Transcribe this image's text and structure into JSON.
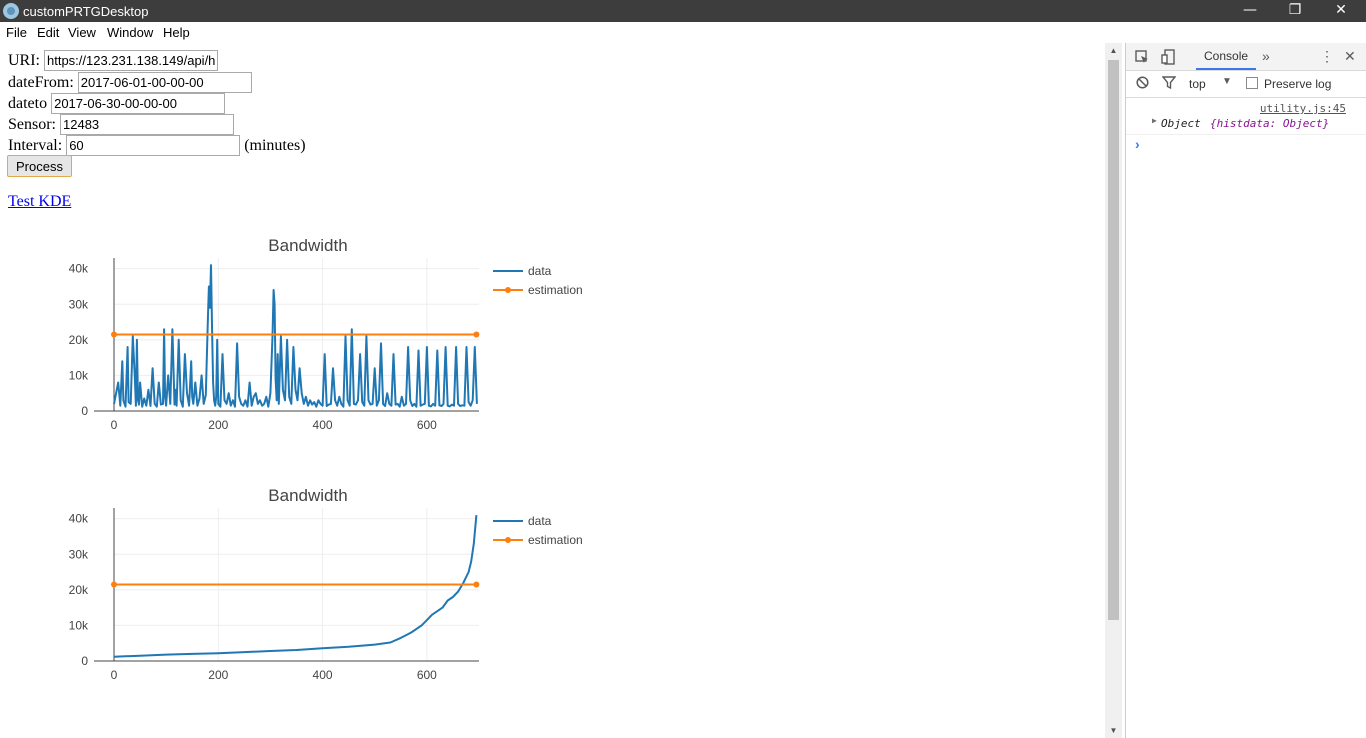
{
  "window": {
    "title": "customPRTGDesktop",
    "minimize": "—",
    "restore": "❐",
    "close": "✕"
  },
  "menu": [
    "File",
    "Edit",
    "View",
    "Window",
    "Help"
  ],
  "form": {
    "uri_label": "URI:",
    "uri_value": "https://123.231.138.149/api/h",
    "datefrom_label": "dateFrom:",
    "datefrom_value": "2017-06-01-00-00-00",
    "dateto_label": "dateto",
    "dateto_value": "2017-06-30-00-00-00",
    "sensor_label": "Sensor:",
    "sensor_value": "12483",
    "interval_label": "Interval:",
    "interval_value": "60",
    "interval_unit": "(minutes)",
    "process_label": "Process"
  },
  "link": {
    "label": "Test KDE"
  },
  "devtools": {
    "tab_console": "Console",
    "more_tabs": "»",
    "context": "top",
    "preserve_log": "Preserve log",
    "log_source": "utility.js:45",
    "log_prefix": "Object ",
    "log_body": "{histdata: Object}",
    "prompt": "›"
  },
  "colors": {
    "data": "#1f77b4",
    "estimation": "#ff7f0e"
  },
  "chart_data": [
    {
      "type": "line",
      "title": "Bandwidth",
      "ylim": [
        0,
        43000
      ],
      "xlim": [
        0,
        700
      ],
      "xticks": [
        0,
        200,
        400,
        600
      ],
      "yticks": [
        0,
        10000,
        20000,
        30000,
        40000
      ],
      "ytick_labels": [
        "0",
        "10k",
        "20k",
        "30k",
        "40k"
      ],
      "legend_position": "top-right",
      "grid": true,
      "series": [
        {
          "name": "data",
          "x": [
            0,
            8,
            12,
            16,
            18,
            22,
            26,
            28,
            32,
            36,
            40,
            42,
            44,
            46,
            48,
            50,
            54,
            58,
            62,
            66,
            70,
            74,
            78,
            82,
            86,
            90,
            94,
            96,
            98,
            100,
            104,
            108,
            112,
            116,
            118,
            120,
            124,
            128,
            132,
            136,
            140,
            144,
            148,
            150,
            152,
            156,
            160,
            164,
            168,
            172,
            176,
            180,
            182,
            184,
            186,
            188,
            190,
            192,
            194,
            196,
            198,
            200,
            204,
            208,
            212,
            216,
            220,
            224,
            228,
            232,
            236,
            240,
            244,
            248,
            252,
            256,
            260,
            264,
            268,
            272,
            276,
            280,
            284,
            288,
            292,
            296,
            300,
            304,
            306,
            308,
            310,
            312,
            314,
            316,
            320,
            324,
            328,
            332,
            336,
            340,
            344,
            348,
            352,
            356,
            360,
            364,
            368,
            372,
            376,
            380,
            384,
            388,
            392,
            396,
            400,
            404,
            408,
            412,
            416,
            420,
            424,
            428,
            432,
            436,
            440,
            444,
            448,
            452,
            456,
            460,
            464,
            468,
            472,
            476,
            480,
            484,
            488,
            492,
            496,
            500,
            504,
            508,
            512,
            516,
            520,
            524,
            528,
            532,
            536,
            540,
            544,
            548,
            552,
            556,
            560,
            564,
            568,
            572,
            576,
            580,
            584,
            588,
            592,
            596,
            600,
            604,
            608,
            612,
            616,
            620,
            624,
            628,
            632,
            636,
            640,
            644,
            648,
            652,
            656,
            660,
            664,
            668,
            672,
            676,
            680,
            684,
            688,
            692,
            696
          ],
          "y": [
            2000,
            8000,
            1500,
            14000,
            3000,
            1200,
            18000,
            2500,
            2000,
            21000,
            9000,
            1500,
            20000,
            3000,
            1800,
            8000,
            1200,
            3500,
            1500,
            6000,
            1400,
            12000,
            2000,
            1200,
            8000,
            1800,
            2000,
            23000,
            4000,
            1500,
            10000,
            2000,
            23000,
            1800,
            6000,
            1500,
            20000,
            3000,
            1200,
            16000,
            5000,
            1500,
            14000,
            4000,
            2000,
            8000,
            1500,
            3500,
            10000,
            2000,
            4500,
            26000,
            35000,
            29000,
            41000,
            24000,
            8000,
            3000,
            1500,
            4000,
            20000,
            2000,
            1200,
            16000,
            3000,
            2000,
            5000,
            1500,
            3000,
            1200,
            19000,
            4000,
            2000,
            1500,
            3000,
            1200,
            8000,
            1500,
            4000,
            5000,
            2000,
            3000,
            1500,
            2000,
            4000,
            1200,
            5000,
            21000,
            34000,
            30000,
            9000,
            3000,
            16000,
            2000,
            21000,
            6000,
            3000,
            20000,
            4000,
            2000,
            18000,
            6000,
            3000,
            12000,
            5000,
            2000,
            4000,
            1500,
            3000,
            1800,
            2500,
            1200,
            3000,
            2000,
            1500,
            16000,
            1400,
            1800,
            2000,
            12000,
            3000,
            1500,
            4000,
            2000,
            1200,
            21000,
            3000,
            1500,
            23000,
            2000,
            1800,
            3000,
            16000,
            2500,
            1500,
            21000,
            3000,
            1800,
            2000,
            12000,
            1500,
            3000,
            19000,
            2000,
            1400,
            5000,
            2000,
            1500,
            16000,
            1800,
            2000,
            1200,
            4000,
            1500,
            2000,
            18000,
            3000,
            1400,
            2000,
            1200,
            17000,
            1500,
            1800,
            2000,
            18000,
            1500,
            1300,
            2000,
            1500,
            17000,
            1600,
            1400,
            2000,
            18000,
            1500,
            1300,
            1800,
            1500,
            18000,
            2000,
            1400,
            1600,
            1500,
            18000,
            2500,
            1500,
            3000,
            18000,
            2000
          ]
        },
        {
          "name": "estimation",
          "x": [
            0,
            695
          ],
          "y": [
            21500,
            21500
          ]
        }
      ]
    },
    {
      "type": "line",
      "title": "Bandwidth",
      "ylim": [
        0,
        43000
      ],
      "xlim": [
        0,
        700
      ],
      "xticks": [
        0,
        200,
        400,
        600
      ],
      "yticks": [
        0,
        10000,
        20000,
        30000,
        40000
      ],
      "ytick_labels": [
        "0",
        "10k",
        "20k",
        "30k",
        "40k"
      ],
      "legend_position": "top-right",
      "grid": true,
      "series": [
        {
          "name": "data",
          "x": [
            0,
            50,
            100,
            150,
            200,
            250,
            300,
            350,
            400,
            450,
            500,
            530,
            550,
            570,
            590,
            600,
            610,
            620,
            630,
            640,
            650,
            660,
            670,
            680,
            685,
            690,
            695
          ],
          "y": [
            1200,
            1500,
            1800,
            2000,
            2200,
            2500,
            2800,
            3100,
            3600,
            4000,
            4600,
            5200,
            6500,
            8000,
            10000,
            11500,
            13000,
            14000,
            15000,
            17000,
            18000,
            19500,
            22000,
            25000,
            28000,
            33000,
            41000
          ]
        },
        {
          "name": "estimation",
          "x": [
            0,
            695
          ],
          "y": [
            21500,
            21500
          ]
        }
      ]
    }
  ]
}
